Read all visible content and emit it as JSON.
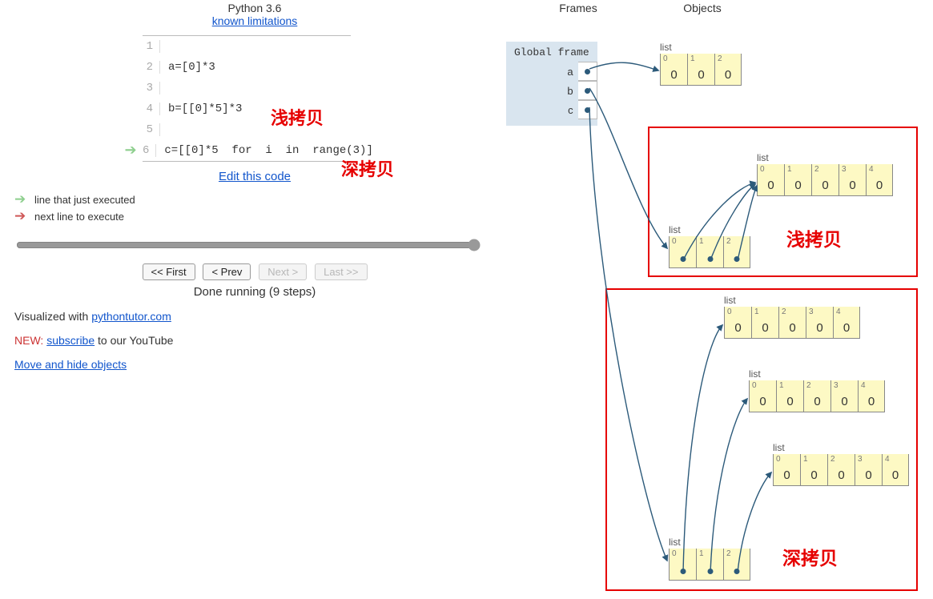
{
  "header": {
    "python_version": "Python 3.6",
    "limitations_link": "known limitations"
  },
  "code": {
    "lines": [
      {
        "n": 1,
        "text": ""
      },
      {
        "n": 2,
        "text": "a=[0]*3"
      },
      {
        "n": 3,
        "text": ""
      },
      {
        "n": 4,
        "text": "b=[[0]*5]*3"
      },
      {
        "n": 5,
        "text": ""
      },
      {
        "n": 6,
        "text": "c=[[0]*5  for  i  in  range(3)]"
      }
    ],
    "just_executed_line": 6
  },
  "annotations": {
    "shallow": "浅拷贝",
    "deep": "深拷贝"
  },
  "edit_link": "Edit this code",
  "legend": {
    "just_executed": "line that just executed",
    "next_line": "next line to execute"
  },
  "nav": {
    "first": "<< First",
    "prev": "< Prev",
    "next": "Next >",
    "last": "Last >>"
  },
  "status": "Done running (9 steps)",
  "credits": {
    "visualized_prefix": "Visualized with ",
    "visualized_link": "pythontutor.com",
    "new_prefix": "NEW: ",
    "subscribe_link": "subscribe",
    "subscribe_suffix": " to our YouTube",
    "move_hide": "Move and hide objects"
  },
  "vis": {
    "col_frames": "Frames",
    "col_objects": "Objects",
    "global_title": "Global frame",
    "vars": [
      "a",
      "b",
      "c"
    ],
    "list_label": "list",
    "list_a": {
      "indices": [
        0,
        1,
        2
      ],
      "values": [
        "0",
        "0",
        "0"
      ]
    },
    "list_5_vals": {
      "indices": [
        0,
        1,
        2,
        3,
        4
      ],
      "values": [
        "0",
        "0",
        "0",
        "0",
        "0"
      ]
    },
    "list_b": {
      "indices": [
        0,
        1,
        2
      ]
    },
    "list_c": {
      "indices": [
        0,
        1,
        2
      ]
    }
  }
}
